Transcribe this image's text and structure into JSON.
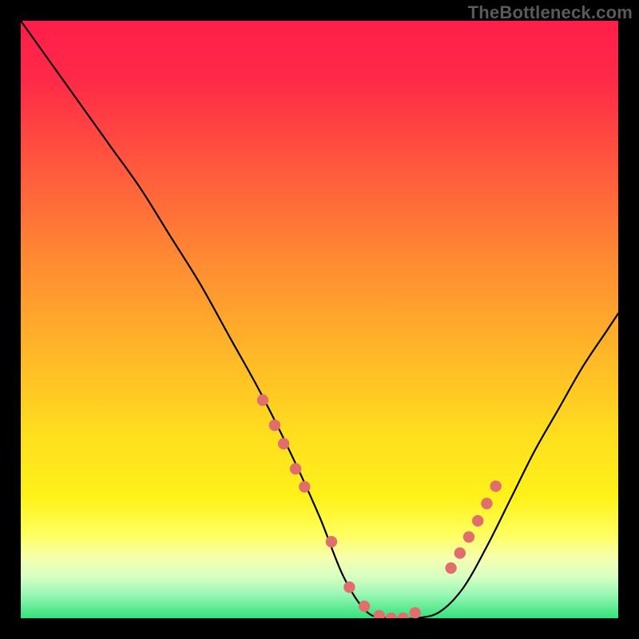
{
  "watermark": "TheBottleneck.com",
  "colors": {
    "gradient_stops": [
      {
        "offset": 0.0,
        "color": "#ff1e4b"
      },
      {
        "offset": 0.1,
        "color": "#ff2a47"
      },
      {
        "offset": 0.25,
        "color": "#ff5a3e"
      },
      {
        "offset": 0.4,
        "color": "#ff8a33"
      },
      {
        "offset": 0.55,
        "color": "#ffb528"
      },
      {
        "offset": 0.7,
        "color": "#ffe01e"
      },
      {
        "offset": 0.8,
        "color": "#fff21a"
      },
      {
        "offset": 0.86,
        "color": "#ffff60"
      },
      {
        "offset": 0.9,
        "color": "#f5ffb0"
      },
      {
        "offset": 0.93,
        "color": "#d8ffc2"
      },
      {
        "offset": 0.96,
        "color": "#99f7b5"
      },
      {
        "offset": 1.0,
        "color": "#34e27a"
      }
    ],
    "curve": "#000000",
    "dot_fill": "#e26d6d",
    "dot_stroke": "#c95a5a",
    "frame": "#000000"
  },
  "chart_data": {
    "type": "line",
    "title": "",
    "xlabel": "",
    "ylabel": "",
    "xlim": [
      0,
      100
    ],
    "ylim": [
      0,
      100
    ],
    "grid": false,
    "legend": false,
    "series": [
      {
        "name": "bottleneck-curve",
        "x": [
          0,
          5,
          10,
          15,
          20,
          25,
          30,
          35,
          40,
          45,
          50,
          54,
          58,
          62,
          66,
          70,
          74,
          78,
          82,
          86,
          90,
          94,
          98,
          100
        ],
        "y": [
          100,
          93,
          86,
          79,
          72,
          64,
          56,
          47,
          38,
          28,
          17,
          7,
          1,
          0,
          0,
          1,
          5,
          12,
          20,
          28,
          35,
          42,
          48,
          51
        ]
      }
    ],
    "highlight_dots": {
      "name": "highlighted-points",
      "x": [
        40.5,
        42.5,
        44.0,
        46.0,
        47.5,
        52.0,
        55.0,
        57.5,
        60.0,
        62.0,
        64.0,
        66.0,
        72.0,
        73.5,
        75.0,
        76.5,
        78.0,
        79.5
      ],
      "y": [
        36.5,
        32.3,
        29.2,
        25.0,
        22.0,
        12.8,
        5.2,
        2.0,
        0.4,
        0.0,
        0.0,
        0.9,
        8.4,
        10.9,
        13.6,
        16.3,
        19.2,
        22.1
      ]
    }
  }
}
